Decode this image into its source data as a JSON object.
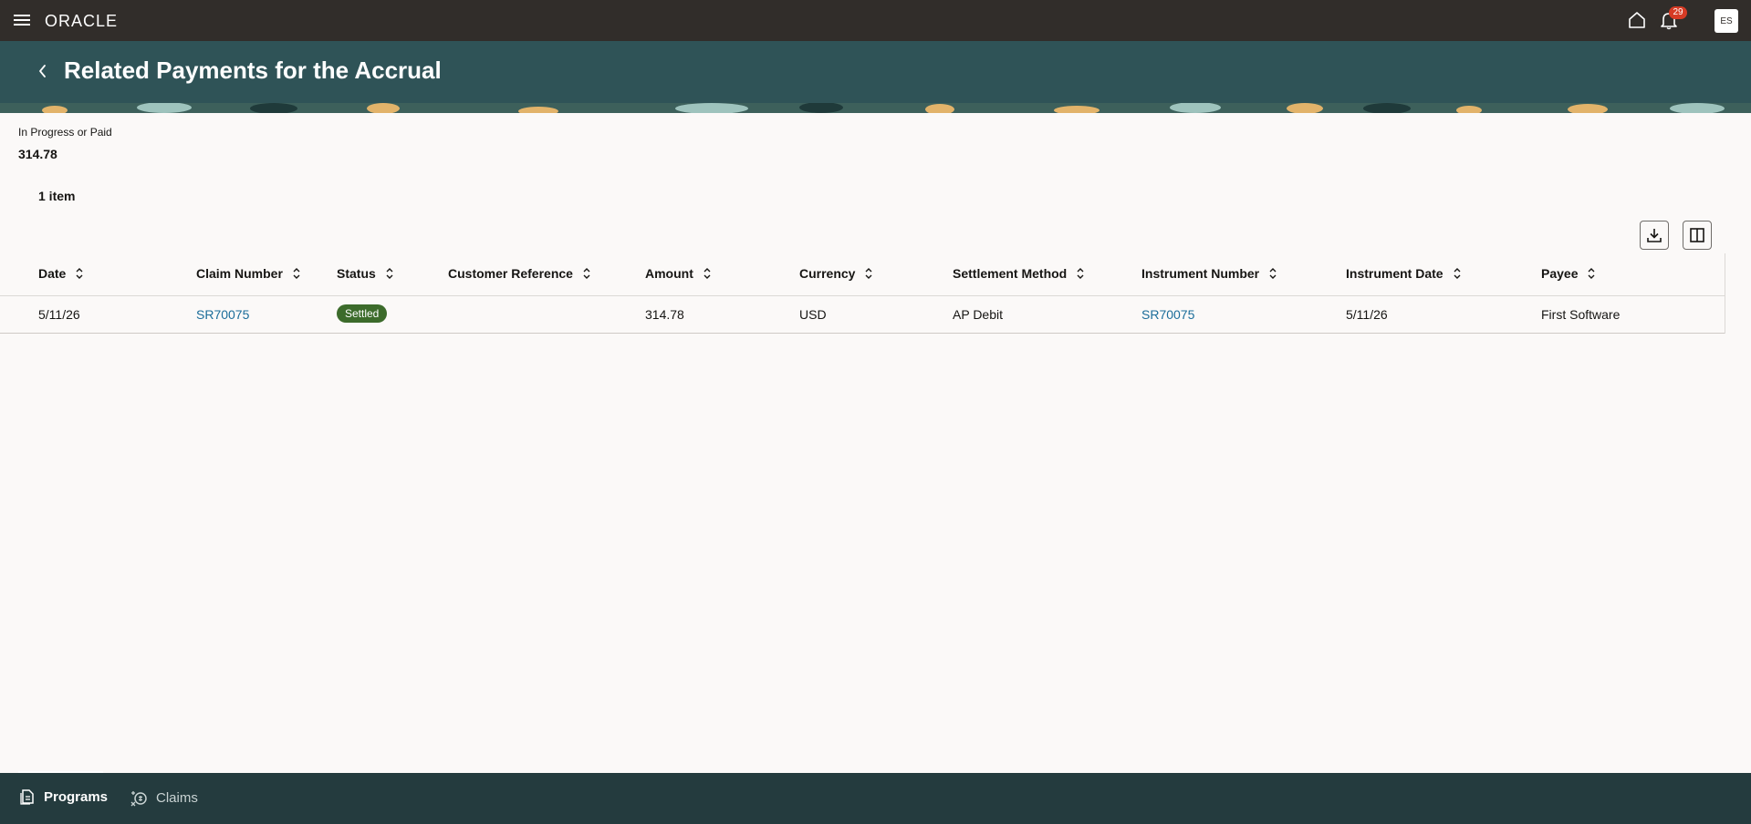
{
  "app": {
    "brand": "ORACLE",
    "notification_count": "29",
    "user_initials": "ES"
  },
  "header": {
    "title": "Related Payments for the Accrual"
  },
  "summary": {
    "label": "In Progress or Paid",
    "value": "314.78"
  },
  "table": {
    "item_count": "1 item",
    "columns": [
      "Date",
      "Claim Number",
      "Status",
      "Customer Reference",
      "Amount",
      "Currency",
      "Settlement Method",
      "Instrument Number",
      "Instrument Date",
      "Payee"
    ],
    "rows": [
      {
        "date": "5/11/26",
        "claim_number": "SR70075",
        "status": "Settled",
        "customer_reference": "",
        "amount": "314.78",
        "currency": "USD",
        "settlement_method": "AP Debit",
        "instrument_number": "SR70075",
        "instrument_date": "5/11/26",
        "payee": "First Software"
      }
    ]
  },
  "bottom_nav": {
    "tabs": [
      {
        "label": "Programs",
        "icon": "programs-icon",
        "active": true
      },
      {
        "label": "Claims",
        "icon": "claims-icon",
        "active": false
      }
    ]
  },
  "colors": {
    "topbar": "#312d2a",
    "header": "#2f5357",
    "bottom_nav": "#243b3e",
    "link": "#1b6d9a",
    "status_settled": "#3c6b2b",
    "badge": "#d63b25"
  }
}
